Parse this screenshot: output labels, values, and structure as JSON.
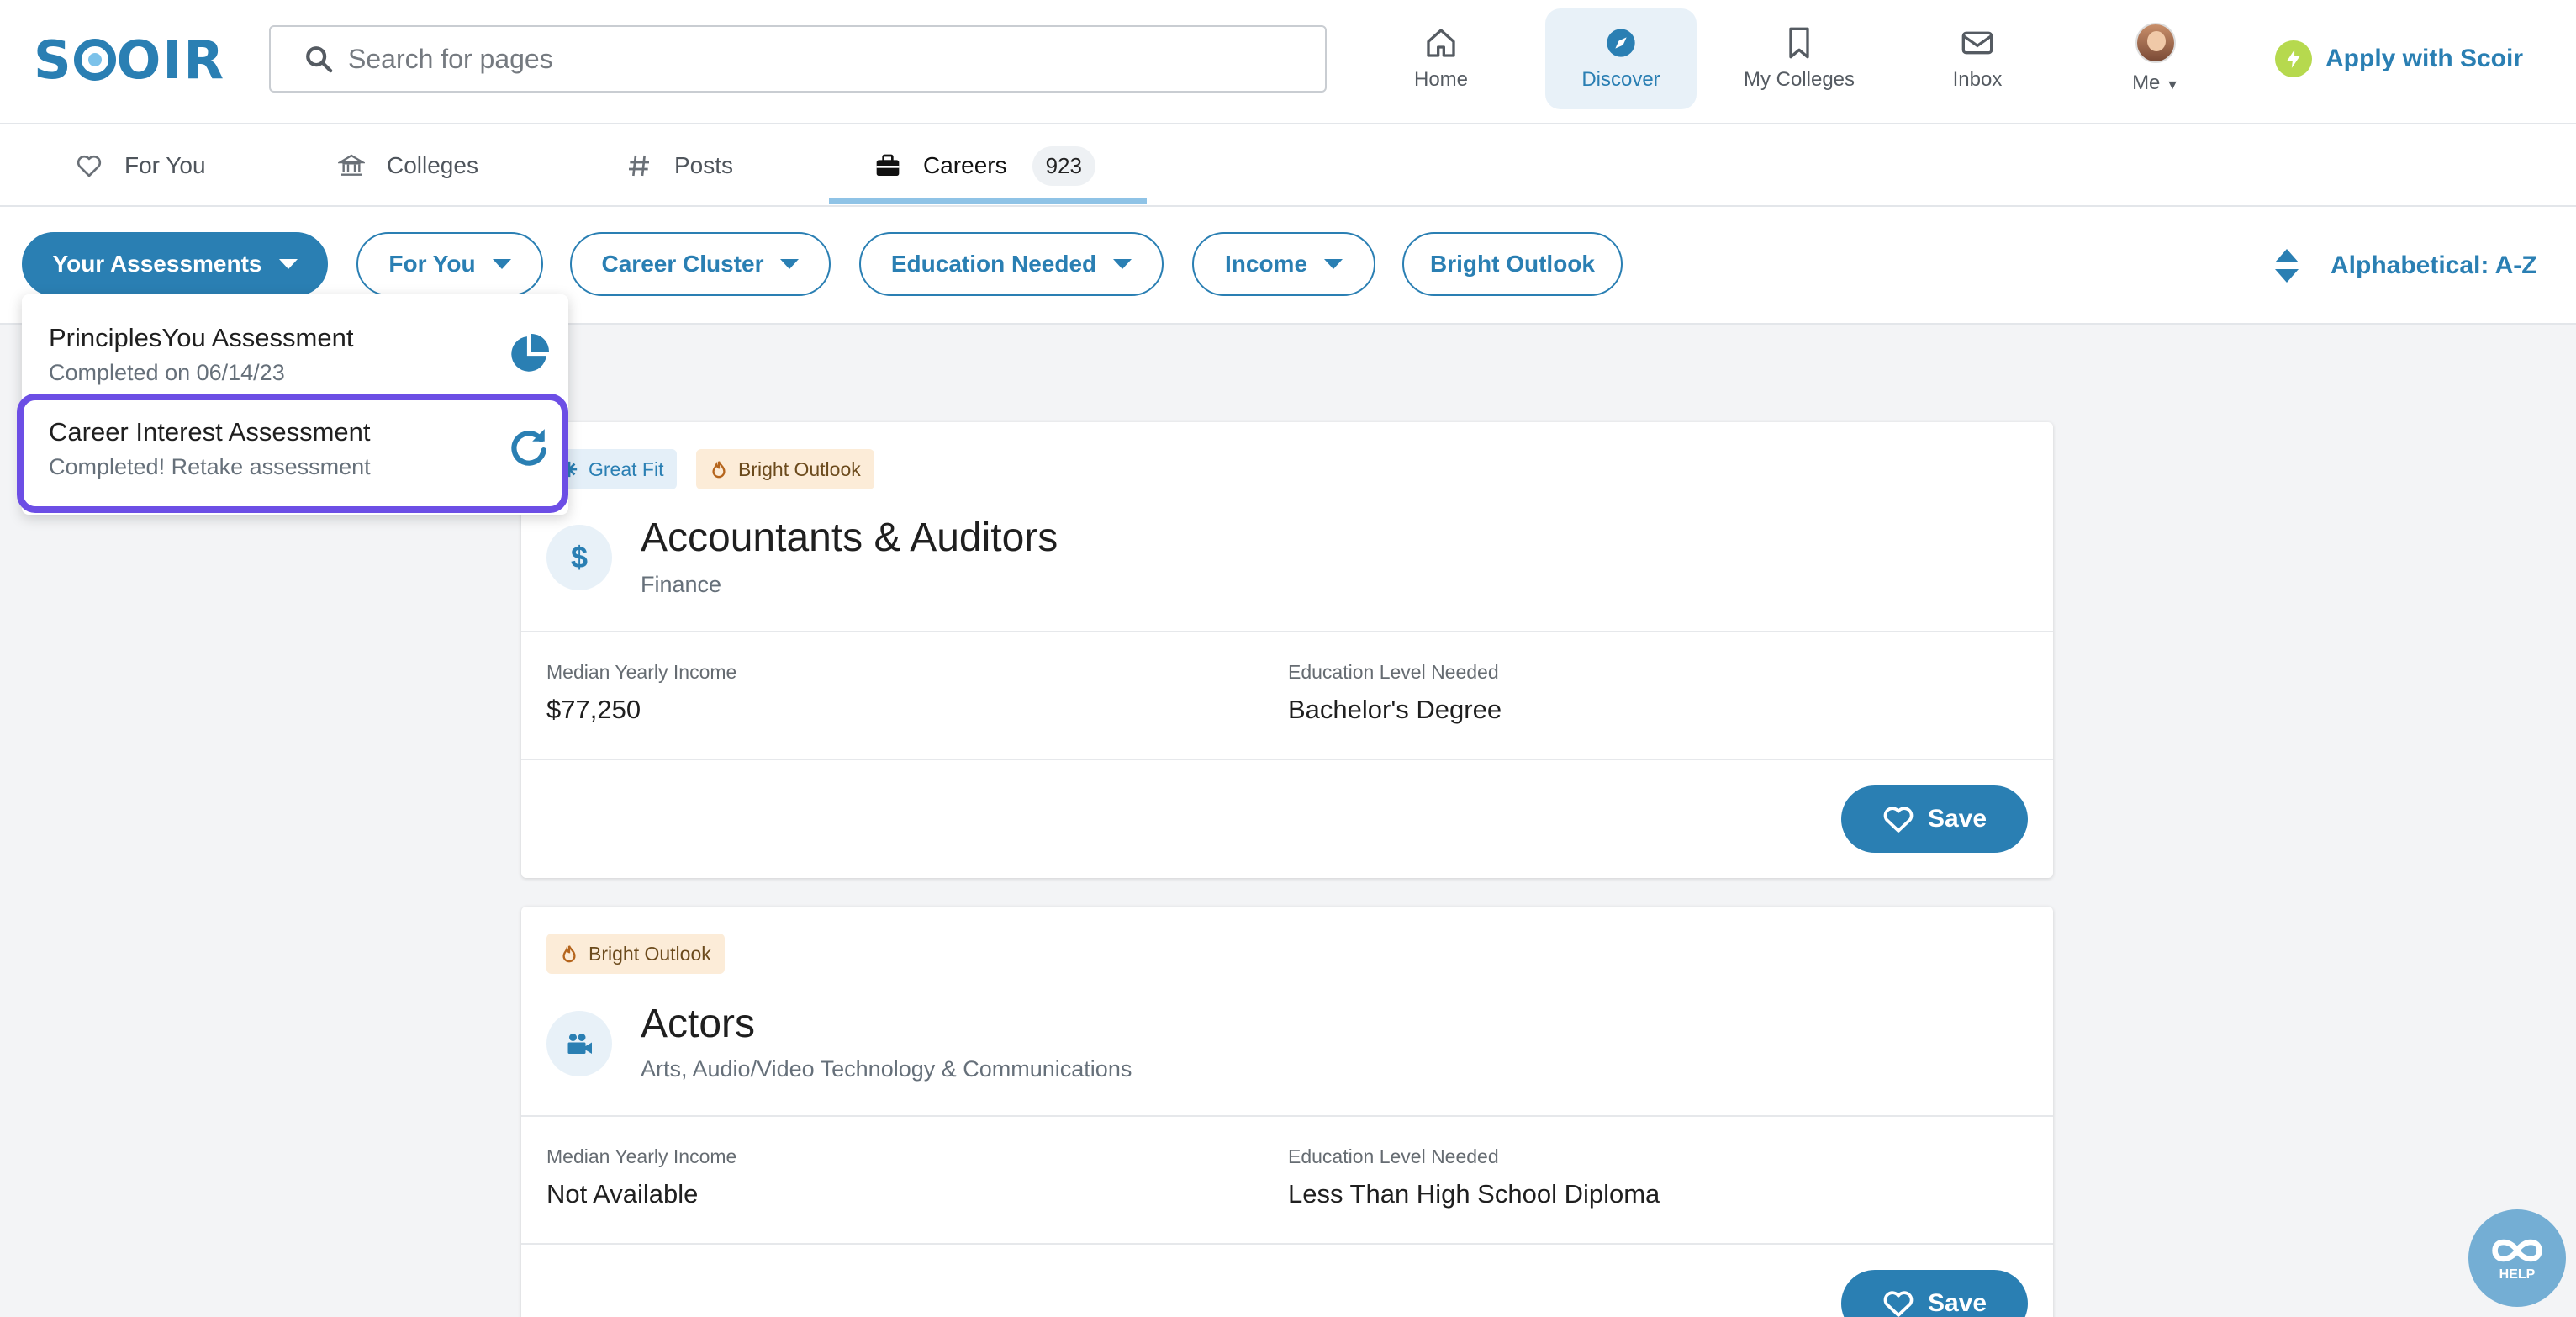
{
  "header": {
    "logo": "SCOIR",
    "search_placeholder": "Search for pages",
    "nav": [
      {
        "label": "Home",
        "icon": "home-icon"
      },
      {
        "label": "Discover",
        "icon": "compass-icon",
        "active": true
      },
      {
        "label": "My Colleges",
        "icon": "bookmark-icon"
      },
      {
        "label": "Inbox",
        "icon": "envelope-icon"
      },
      {
        "label": "Me",
        "icon": "avatar"
      }
    ],
    "apply_label": "Apply with Scoir"
  },
  "tabs": [
    {
      "label": "For You",
      "icon": "heart-icon"
    },
    {
      "label": "Colleges",
      "icon": "institution-icon"
    },
    {
      "label": "Posts",
      "icon": "hash-icon"
    },
    {
      "label": "Careers",
      "icon": "briefcase-icon",
      "active": true,
      "count": "923"
    }
  ],
  "filters": [
    {
      "label": "Your Assessments",
      "caret": true,
      "active": true
    },
    {
      "label": "For You",
      "caret": true
    },
    {
      "label": "Career Cluster",
      "caret": true
    },
    {
      "label": "Education Needed",
      "caret": true
    },
    {
      "label": "Income",
      "caret": true
    },
    {
      "label": "Bright Outlook",
      "caret": false
    }
  ],
  "sort_label": "Alphabetical: A-Z",
  "assessments_menu": [
    {
      "title": "PrinciplesYou Assessment",
      "subtitle": "Completed on 06/14/23",
      "icon": "pie-chart-icon"
    },
    {
      "title": "Career Interest Assessment",
      "subtitle": "Completed! Retake assessment",
      "icon": "retake-icon"
    }
  ],
  "careers": [
    {
      "badges": [
        {
          "label": "Great Fit",
          "type": "fit"
        },
        {
          "label": "Bright Outlook",
          "type": "bright"
        }
      ],
      "title": "Accountants & Auditors",
      "cluster": "Finance",
      "icon": "dollar-icon",
      "income_label": "Median Yearly Income",
      "income": "$77,250",
      "education_label": "Education Level Needed",
      "education": "Bachelor's Degree",
      "save_label": "Save"
    },
    {
      "badges": [
        {
          "label": "Bright Outlook",
          "type": "bright"
        }
      ],
      "title": "Actors",
      "cluster": "Arts, Audio/Video Technology & Communications",
      "icon": "video-camera-icon",
      "income_label": "Median Yearly Income",
      "income": "Not Available",
      "education_label": "Education Level Needed",
      "education": "Less Than High School Diploma",
      "save_label": "Save"
    }
  ],
  "help_label": "HELP",
  "colors": {
    "accent": "#2a7fb3",
    "highlight": "#6c4ee5",
    "bright_bg": "#fcecd8"
  }
}
